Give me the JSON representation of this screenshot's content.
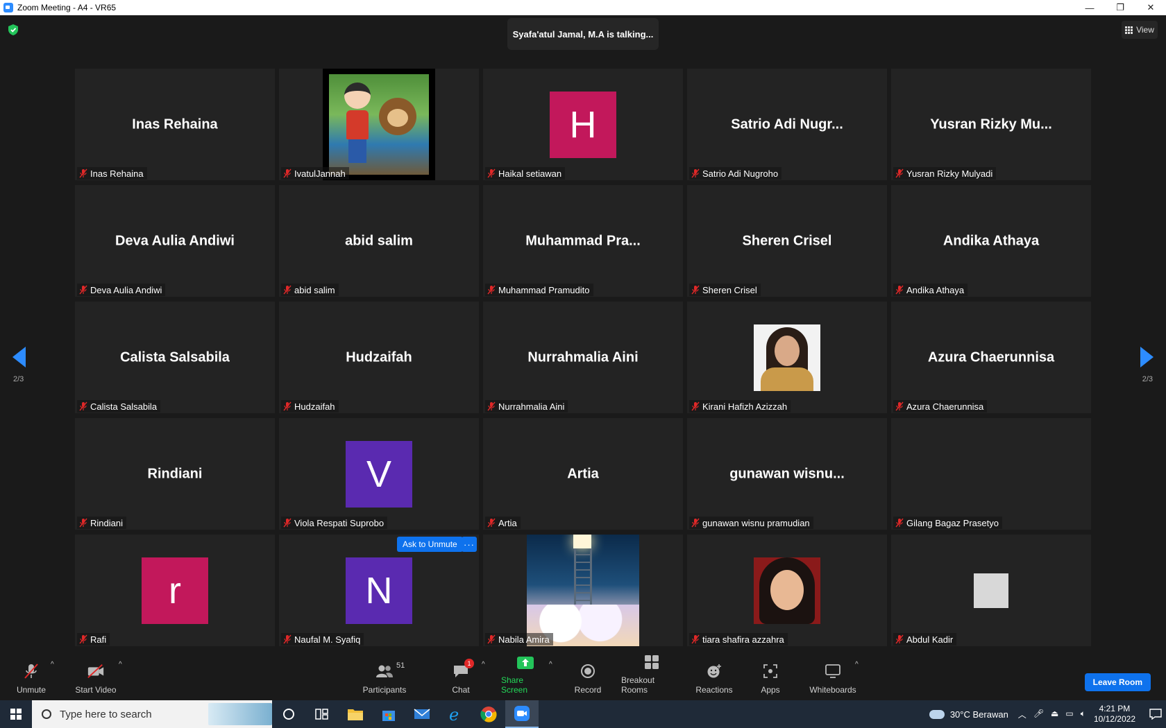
{
  "window": {
    "title": "Zoom Meeting - A4 - VR65",
    "minimize": "—",
    "restore": "❐",
    "close": "✕"
  },
  "meeting": {
    "talking": "Syafa'atul Jamal, M.A is talking...",
    "view_label": "View",
    "page_left": "2/3",
    "page_right": "2/3",
    "ask_to_unmute": "Ask to Unmute",
    "more": "···"
  },
  "tiles": [
    {
      "center": "Inas Rehaina",
      "name": "Inas Rehaina"
    },
    {
      "center": "",
      "name": "IvatulJannah",
      "media": "cartoon-boy-monkey"
    },
    {
      "center": "",
      "name": "Haikal setiawan",
      "avatar": "H",
      "avatar_color": "#c2185b"
    },
    {
      "center": "Satrio Adi Nugr...",
      "name": "Satrio Adi Nugroho"
    },
    {
      "center": "Yusran Rizky Mu...",
      "name": "Yusran Rizky Mulyadi"
    },
    {
      "center": "Deva Aulia Andiwi",
      "name": "Deva Aulia Andiwi"
    },
    {
      "center": "abid salim",
      "name": "abid salim"
    },
    {
      "center": "Muhammad Pra...",
      "name": "Muhammad Pramudito"
    },
    {
      "center": "Sheren Crisel",
      "name": "Sheren Crisel"
    },
    {
      "center": "Andika Athaya",
      "name": "Andika Athaya"
    },
    {
      "center": "Calista Salsabila",
      "name": "Calista Salsabila"
    },
    {
      "center": "Hudzaifah",
      "name": "Hudzaifah"
    },
    {
      "center": "Nurrahmalia Aini",
      "name": "Nurrahmalia Aini"
    },
    {
      "center": "",
      "name": "Kirani Hafizh Azizzah",
      "media": "girl-photo"
    },
    {
      "center": "Azura Chaerunnisa",
      "name": "Azura Chaerunnisa"
    },
    {
      "center": "Rindiani",
      "name": "Rindiani"
    },
    {
      "center": "",
      "name": "Viola Respati Suprobo",
      "avatar": "V",
      "avatar_color": "#5a2ab0"
    },
    {
      "center": "Artia",
      "name": "Artia"
    },
    {
      "center": "gunawan wisnu...",
      "name": "gunawan wisnu pramudian"
    },
    {
      "center": "",
      "name": "Gilang Bagaz Prasetyo"
    },
    {
      "center": "",
      "name": "Rafi",
      "avatar": "r",
      "avatar_color": "#c2185b"
    },
    {
      "center": "",
      "name": "Naufal M. Syafiq",
      "avatar": "N",
      "avatar_color": "#5a2ab0"
    },
    {
      "center": "",
      "name": "Nabila Amira",
      "media": "ladder-clouds"
    },
    {
      "center": "",
      "name": "tiara shafira azzahra",
      "media": "girl-selfie"
    },
    {
      "center": "",
      "name": "Abdul Kadir",
      "media": "grey-image"
    }
  ],
  "toolbar": {
    "unmute": "Unmute",
    "start_video": "Start Video",
    "participants": "Participants",
    "participants_count": "51",
    "chat": "Chat",
    "chat_badge": "1",
    "share_screen": "Share Screen",
    "record": "Record",
    "breakout_rooms": "Breakout Rooms",
    "reactions": "Reactions",
    "apps": "Apps",
    "whiteboards": "Whiteboards",
    "leave_room": "Leave Room",
    "caret": "^"
  },
  "taskbar": {
    "search_placeholder": "Type here to search",
    "weather": "30°C  Berawan",
    "time": "4:21 PM",
    "date": "10/12/2022"
  },
  "colors": {
    "accent": "#2d8cff",
    "button_blue": "#0e72ed",
    "share_green": "#23d959",
    "mic_off_red": "#e02828"
  }
}
